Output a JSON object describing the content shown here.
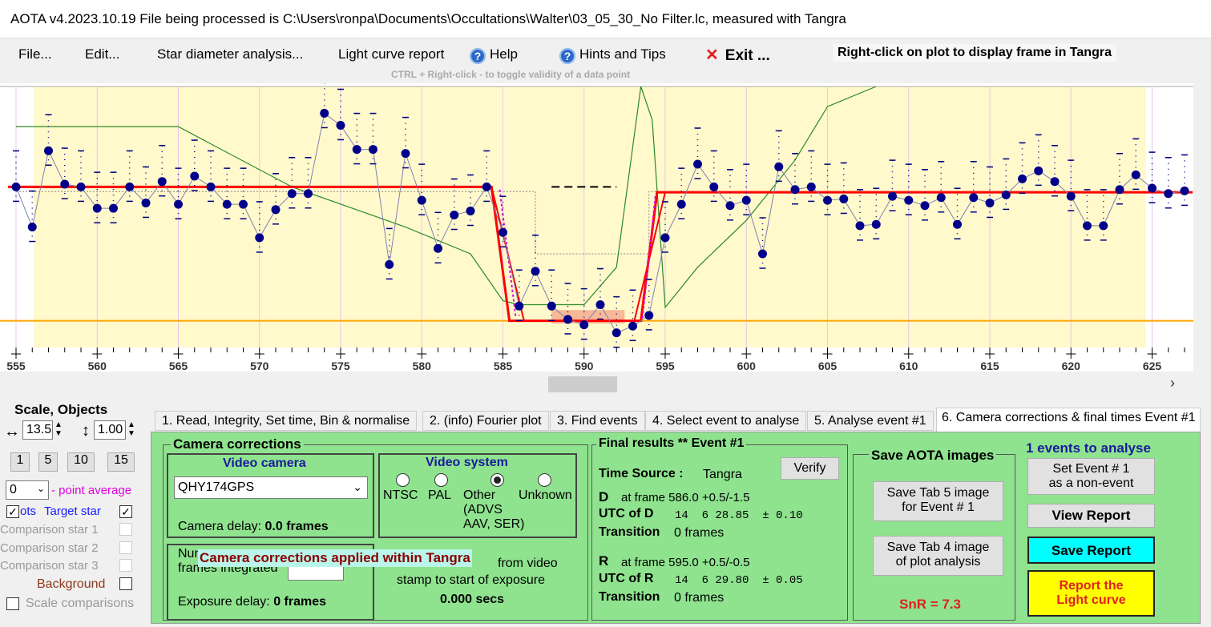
{
  "window": {
    "title": "AOTA v4.2023.10.19    File being processed is C:\\Users\\ronpa\\Documents\\Occultations\\Walter\\03_05_30_No Filter.lc, measured with Tangra"
  },
  "menu": {
    "file": "File...",
    "edit": "Edit...",
    "star_diameter": "Star diameter analysis...",
    "light_curve_report": "Light curve report",
    "help": "Help",
    "hints": "Hints and Tips",
    "exit": "Exit ..."
  },
  "hint_right_click": "Right-click on plot to display frame in Tangra",
  "hint_ctrl": "CTRL + Right-click  -  to toggle validity of a data point",
  "chart_data": {
    "type": "line",
    "x": [
      555,
      556,
      557,
      558,
      559,
      560,
      561,
      562,
      563,
      564,
      565,
      566,
      567,
      568,
      569,
      570,
      571,
      572,
      573,
      574,
      575,
      576,
      577,
      578,
      579,
      580,
      581,
      582,
      583,
      584,
      585,
      586,
      587,
      588,
      589,
      590,
      591,
      592,
      593,
      594,
      595,
      596,
      597,
      598,
      599,
      600,
      601,
      602,
      603,
      604,
      605,
      606,
      607,
      608,
      609,
      610,
      611,
      612,
      613,
      614,
      615,
      616,
      617,
      618,
      619,
      620,
      621,
      622,
      623,
      624,
      625,
      626,
      627
    ],
    "y": [
      1.0,
      0.7,
      1.27,
      1.02,
      1.0,
      0.84,
      0.84,
      1.0,
      0.88,
      1.04,
      0.87,
      1.08,
      1.0,
      0.87,
      0.87,
      0.62,
      0.83,
      0.95,
      0.95,
      1.55,
      1.46,
      1.28,
      1.28,
      0.42,
      1.25,
      0.9,
      0.54,
      0.79,
      0.82,
      1.0,
      0.66,
      0.11,
      0.37,
      0.11,
      0.01,
      -0.03,
      0.12,
      -0.09,
      -0.04,
      0.04,
      0.62,
      0.87,
      1.17,
      1.0,
      0.86,
      0.9,
      0.5,
      1.15,
      0.98,
      1.0,
      0.9,
      0.91,
      0.71,
      0.72,
      0.93,
      0.9,
      0.86,
      0.92,
      0.72,
      0.92,
      0.88,
      0.94,
      1.06,
      1.12,
      1.04,
      0.93,
      0.71,
      0.71,
      0.98,
      1.09,
      0.99,
      0.95,
      0.97
    ],
    "model": {
      "baseline": 1.0,
      "event_bottom": 0.0,
      "D_frame": 586.0,
      "R_frame": 595.0
    },
    "x_ticks": [
      555,
      560,
      565,
      570,
      575,
      580,
      585,
      590,
      595,
      600,
      605,
      610,
      615,
      620,
      625
    ],
    "xlim": [
      554.5,
      627.5
    ],
    "ylim": [
      -0.2,
      1.75
    ],
    "grid": true,
    "colors": {
      "background": "#fff9cc",
      "grid": "#e8c8e8",
      "data": "#00008b",
      "model": "#ff0000",
      "line": "#8080b0",
      "green": "#2a8a2a",
      "orange": "#ffa500"
    }
  },
  "left": {
    "title": "Scale,  Objects",
    "scale_value": "13.5",
    "vscale_value": "1.00",
    "buttons": [
      "1",
      "5",
      "10",
      "15"
    ],
    "avg_value": "0",
    "avg_label": "- point average",
    "plots_label": "ots",
    "target_label": "Target star",
    "comp1": "Comparison star 1",
    "comp2": "Comparison star 2",
    "comp3": "Comparison star 3",
    "background": "Background",
    "scale_comparisons": "Scale comparisons"
  },
  "tabs": [
    "1.  Read, Integrity, Set time, Bin & normalise",
    "2. (info)  Fourier plot",
    "3. Find events",
    "4. Select event to analyse",
    "5. Analyse event #1",
    "6. Camera corrections & final times Event #1"
  ],
  "camera": {
    "group_title": "Camera corrections",
    "video_camera": "Video camera",
    "camera_value": "QHY174GPS",
    "camera_delay_label": "Camera delay:",
    "camera_delay_value": "0.0 frames",
    "video_system": "Video system",
    "radio_ntsc": "NTSC",
    "radio_pal": "PAL",
    "radio_other": "Other\n(ADVS\nAAV, SER)",
    "radio_unknown": "Unknown",
    "frames_integrated_label": "Num\nframes integrated",
    "overlay_text": "Camera corrections applied within Tangra",
    "stamp_text_1": "from video",
    "stamp_text_2": "stamp to start of exposure",
    "stamp_value": "0.000 secs",
    "exposure_delay_label": "Exposure delay:",
    "exposure_delay_value": "0 frames"
  },
  "final": {
    "title": "Final results  **  Event #1",
    "time_source_label": "Time Source :",
    "time_source_value": "Tangra",
    "verify": "Verify",
    "d_label": "D",
    "d_frame": "at frame 586.0  +0.5/-1.5",
    "utc_d_label": "UTC of D",
    "utc_d_value": "14  6 28.85  ± 0.10",
    "transition_label": "Transition",
    "transition_d": "0 frames",
    "r_label": "R",
    "r_frame": "at frame 595.0  +0.5/-0.5",
    "utc_r_label": "UTC of R",
    "utc_r_value": "14  6 29.80  ± 0.05",
    "transition_r": "0 frames",
    "snr": "SnR = 7.3"
  },
  "save": {
    "title": "Save AOTA images",
    "tab5": "Save Tab 5 image\nfor Event # 1",
    "tab4": "Save Tab 4 image\nof plot analysis"
  },
  "events": {
    "count_label": "1  events to analyse",
    "non_event": "Set Event # 1\nas a non-event",
    "view_report": "View Report",
    "save_report": "Save Report",
    "report_lc": "Report the\nLight curve"
  }
}
